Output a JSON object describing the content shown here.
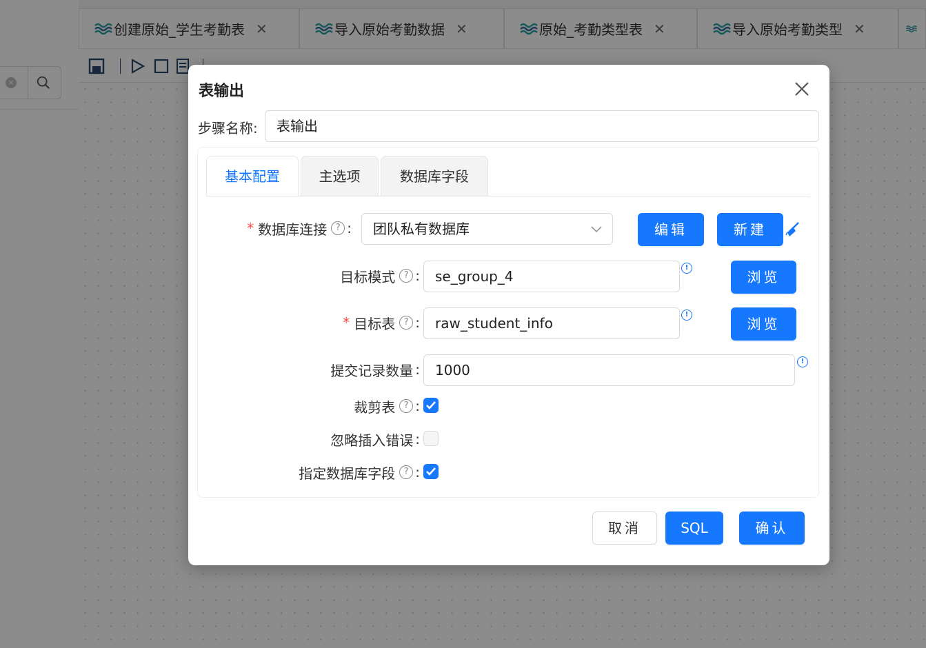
{
  "app": {
    "tabs": [
      {
        "label": "创建原始_学生考勤表"
      },
      {
        "label": "导入原始考勤数据"
      },
      {
        "label": "原始_考勤类型表"
      },
      {
        "label": "导入原始考勤类型"
      }
    ]
  },
  "modal": {
    "title": "表输出",
    "step_name_label": "步骤名称:",
    "step_name_value": "表输出",
    "tabs": [
      {
        "label": "基本配置",
        "active": true
      },
      {
        "label": "主选项",
        "active": false
      },
      {
        "label": "数据库字段",
        "active": false
      }
    ],
    "form": {
      "db_connection": {
        "label": "数据库连接",
        "value": "团队私有数据库",
        "edit_label": "编辑",
        "new_label": "新建"
      },
      "target_schema": {
        "label": "目标模式",
        "value": "se_group_4",
        "browse_label": "浏览"
      },
      "target_table": {
        "label": "目标表",
        "value": "raw_student_info",
        "browse_label": "浏览"
      },
      "commit_size": {
        "label": "提交记录数量",
        "value": "1000"
      },
      "truncate_table": {
        "label": "裁剪表",
        "checked": true
      },
      "ignore_insert_errors": {
        "label": "忽略插入错误",
        "checked": false
      },
      "specify_db_fields": {
        "label": "指定数据库字段",
        "checked": true
      }
    },
    "footer": {
      "cancel_label": "取消",
      "sql_label": "SQL",
      "confirm_label": "确认"
    }
  },
  "colors": {
    "primary": "#1677ff",
    "required": "#ff4d4f",
    "tab_icon": "#2aa3a3"
  }
}
